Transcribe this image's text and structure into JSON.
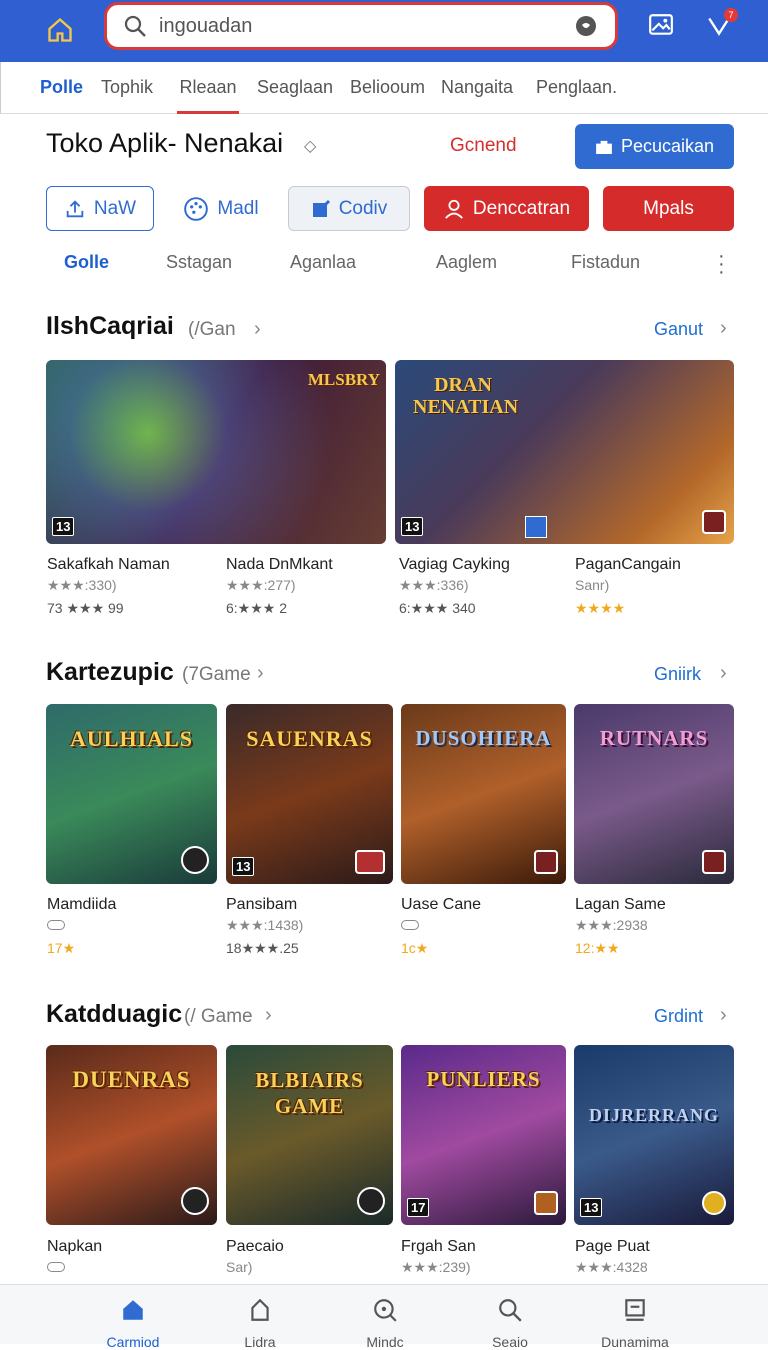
{
  "search": {
    "value": "ingouadan"
  },
  "notification_count": "7",
  "nav_tabs": [
    "Polle",
    "Tophik",
    "Rleaan",
    "Seaglaan",
    "Beliooum",
    "Nangaita",
    "Penglaan."
  ],
  "store": {
    "title": "Toko Aplik- Nenakai",
    "red_link": "Gcnend",
    "primary_button": "Pecucaikan"
  },
  "action_buttons": [
    "NaW",
    "Madl",
    "Codiv",
    "Denccatran",
    "Mpals"
  ],
  "sub_tabs": [
    "Golle",
    "Sstagan",
    "Aganlaa",
    "Aaglem",
    "Fistadun"
  ],
  "sections": [
    {
      "title": "IlshCaqriai",
      "count": "(/Gan",
      "link": "Ganut",
      "games": [
        {
          "name": "Sakafkah Naman",
          "rating": "★★★:330)",
          "price": "73 ★★★ 99"
        },
        {
          "name": "Nada DnMkant",
          "rating": "★★★:277)",
          "price": "6:★★★ 2"
        },
        {
          "name": "Vagiag Cayking",
          "rating": "★★★:336)",
          "price": "6:★★★ 340"
        },
        {
          "name": "PaganCangain",
          "rating": "Sanr)",
          "price": "★★★★"
        }
      ],
      "banners": [
        {
          "logo": "MLSBRY",
          "age": "13"
        },
        {
          "logo": "DRAN NENATIAN",
          "age": "13"
        }
      ]
    },
    {
      "title": "Kartezupic",
      "count": "(7Game",
      "link": "Gniirk",
      "games": [
        {
          "name": "Mamdiida",
          "rating": "",
          "price": "17★",
          "logo": "AULHIALS",
          "age": ""
        },
        {
          "name": "Pansibam",
          "rating": "★★★:1438)",
          "price": "18★★★.25",
          "logo": "SAUENRAS",
          "age": "13"
        },
        {
          "name": "Uase Cane",
          "rating": "",
          "price": "1c★",
          "logo": "DUSOHIERA",
          "age": ""
        },
        {
          "name": "Lagan Same",
          "rating": "★★★:2938",
          "price": "12:★★",
          "logo": "RUTNARS",
          "age": ""
        }
      ]
    },
    {
      "title": "Katdduagic",
      "count": "(/ Game",
      "link": "Grdint",
      "games": [
        {
          "name": "Napkan",
          "rating": "",
          "price": "",
          "logo": "DUENRAS",
          "age": ""
        },
        {
          "name": "Paecaio",
          "rating": "Sar)",
          "price": "",
          "logo": "BLBIAIRS GAME",
          "age": ""
        },
        {
          "name": "Frgah San",
          "rating": "★★★:239)",
          "price": "",
          "logo": "PUNLIERS",
          "age": "17"
        },
        {
          "name": "Page Puat",
          "rating": "★★★:4328",
          "price": "",
          "logo": "DIJRERRANG",
          "age": "13"
        }
      ]
    }
  ],
  "bottom_nav": [
    "Carmiod",
    "Lidra",
    "Mindc",
    "Seaio",
    "Dunamima"
  ]
}
